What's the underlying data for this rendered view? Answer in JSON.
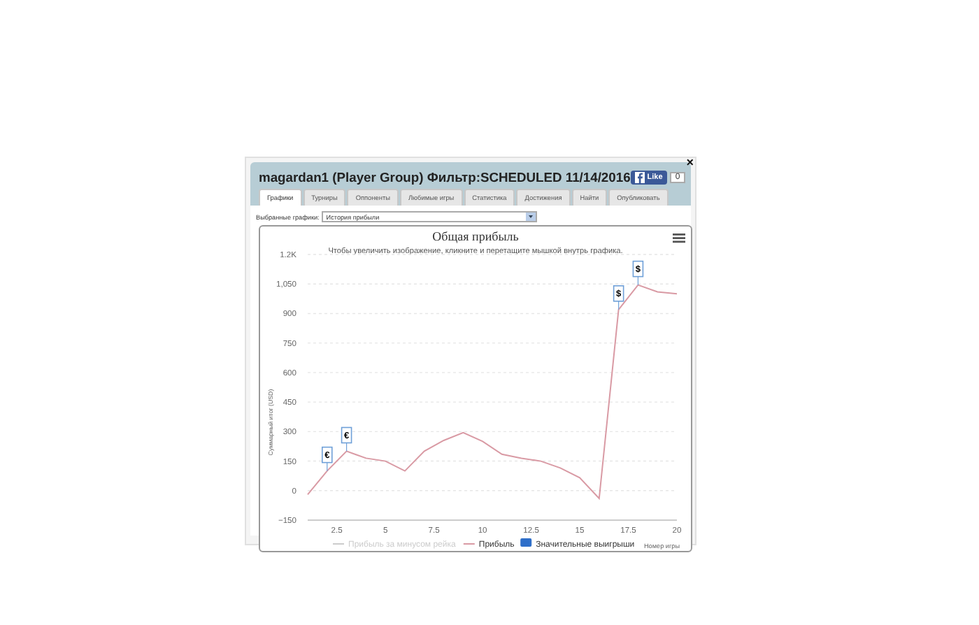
{
  "window": {
    "title": "magardan1 (Player Group) Фильтр:SCHEDULED 11/14/2016",
    "close": "×"
  },
  "like": {
    "label": "Like",
    "count": "0"
  },
  "tabs": [
    {
      "label": "Графики",
      "selected": true
    },
    {
      "label": "Турниры",
      "selected": false
    },
    {
      "label": "Оппоненты",
      "selected": false
    },
    {
      "label": "Любимые игры",
      "selected": false
    },
    {
      "label": "Статистика",
      "selected": false
    },
    {
      "label": "Достижения",
      "selected": false
    },
    {
      "label": "Найти",
      "selected": false
    },
    {
      "label": "Опубликовать",
      "selected": false
    }
  ],
  "chart_select": {
    "label": "Выбранные графики:",
    "value": "История прибыли"
  },
  "chart": {
    "subtitle": "Чтобы увеличить изображение, кликните и перетащите мышкой внутрь графика.",
    "legend": [
      {
        "label": "Прибыль за минусом рейка",
        "kind": "line",
        "visible": false
      },
      {
        "kind": "series",
        "visible": true
      },
      {
        "label": "Значительные выигрыши",
        "kind": "flag",
        "visible": true
      }
    ],
    "chart_data": {
      "type": "line",
      "title": "Общая прибыль",
      "xlabel": "Номер игры",
      "ylabel": "Суммарный итог (USD)",
      "x": [
        1,
        2,
        3,
        4,
        5,
        6,
        7,
        8,
        9,
        10,
        11,
        12,
        13,
        14,
        15,
        16,
        17,
        18,
        19,
        20
      ],
      "series": [
        {
          "name": "Прибыль",
          "color": "#d99aa4",
          "values": [
            -20,
            100,
            200,
            165,
            150,
            100,
            200,
            255,
            295,
            250,
            185,
            165,
            150,
            115,
            65,
            -40,
            920,
            1045,
            1010,
            1000
          ]
        }
      ],
      "grid": true,
      "xlim": [
        1,
        20
      ],
      "ylim": [
        -150,
        1200
      ],
      "xticks": [
        2.5,
        5,
        7.5,
        10,
        12.5,
        15,
        17.5,
        20
      ],
      "yticks": [
        {
          "value": -150,
          "label": "−150"
        },
        {
          "value": 0,
          "label": "0"
        },
        {
          "value": 150,
          "label": "150"
        },
        {
          "value": 300,
          "label": "300"
        },
        {
          "value": 450,
          "label": "450"
        },
        {
          "value": 600,
          "label": "600"
        },
        {
          "value": 750,
          "label": "750"
        },
        {
          "value": 900,
          "label": "900"
        },
        {
          "value": 1050,
          "label": "1,050"
        },
        {
          "value": 1200,
          "label": "1.2K"
        }
      ],
      "annotations": [
        {
          "x": 2,
          "y": 100,
          "text": "€"
        },
        {
          "x": 3,
          "y": 200,
          "text": "€"
        },
        {
          "x": 17,
          "y": 920,
          "text": "$"
        },
        {
          "x": 18,
          "y": 1045,
          "text": "$"
        }
      ]
    }
  }
}
